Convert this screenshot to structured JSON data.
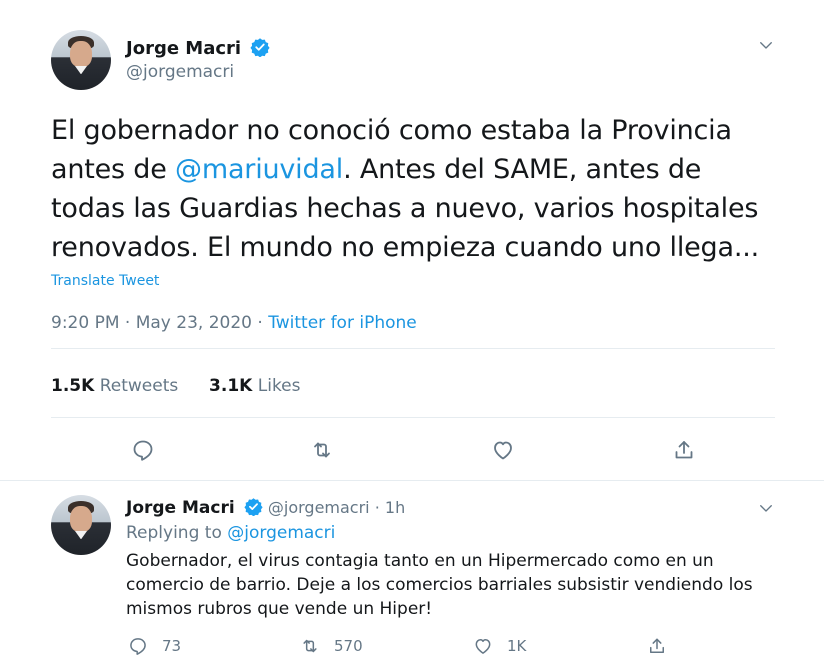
{
  "main_tweet": {
    "author_name": "Jorge Macri",
    "author_handle": "@jorgemacri",
    "text_part1": "El gobernador no conoció como estaba la Provincia antes de ",
    "mention": "@mariuvidal",
    "text_part2": ". Antes del SAME, antes de todas las Guardias hechas a nuevo, varios hospitales renovados. El mundo no empieza cuando uno llega...",
    "translate_label": "Translate Tweet",
    "timestamp": "9:20 PM · May 23, 2020 · ",
    "source": "Twitter for iPhone",
    "retweets_count": "1.5K",
    "retweets_label": "Retweets",
    "likes_count": "3.1K",
    "likes_label": "Likes"
  },
  "reply_tweet": {
    "author_name": "Jorge Macri",
    "author_handle": "@jorgemacri",
    "time": "· 1h",
    "replying_label": "Replying to ",
    "replying_handle": "@jorgemacri",
    "text": "Gobernador, el virus contagia tanto en un Hipermercado como en un comercio de barrio. Deje a los comercios barriales subsistir vendiendo los mismos rubros que vende un Hiper!",
    "reply_count": "73",
    "retweet_count": "570",
    "like_count": "1K"
  },
  "colors": {
    "accent": "#1b95e0",
    "muted": "#657786",
    "text": "#14171a",
    "verified": "#1da1f2"
  }
}
